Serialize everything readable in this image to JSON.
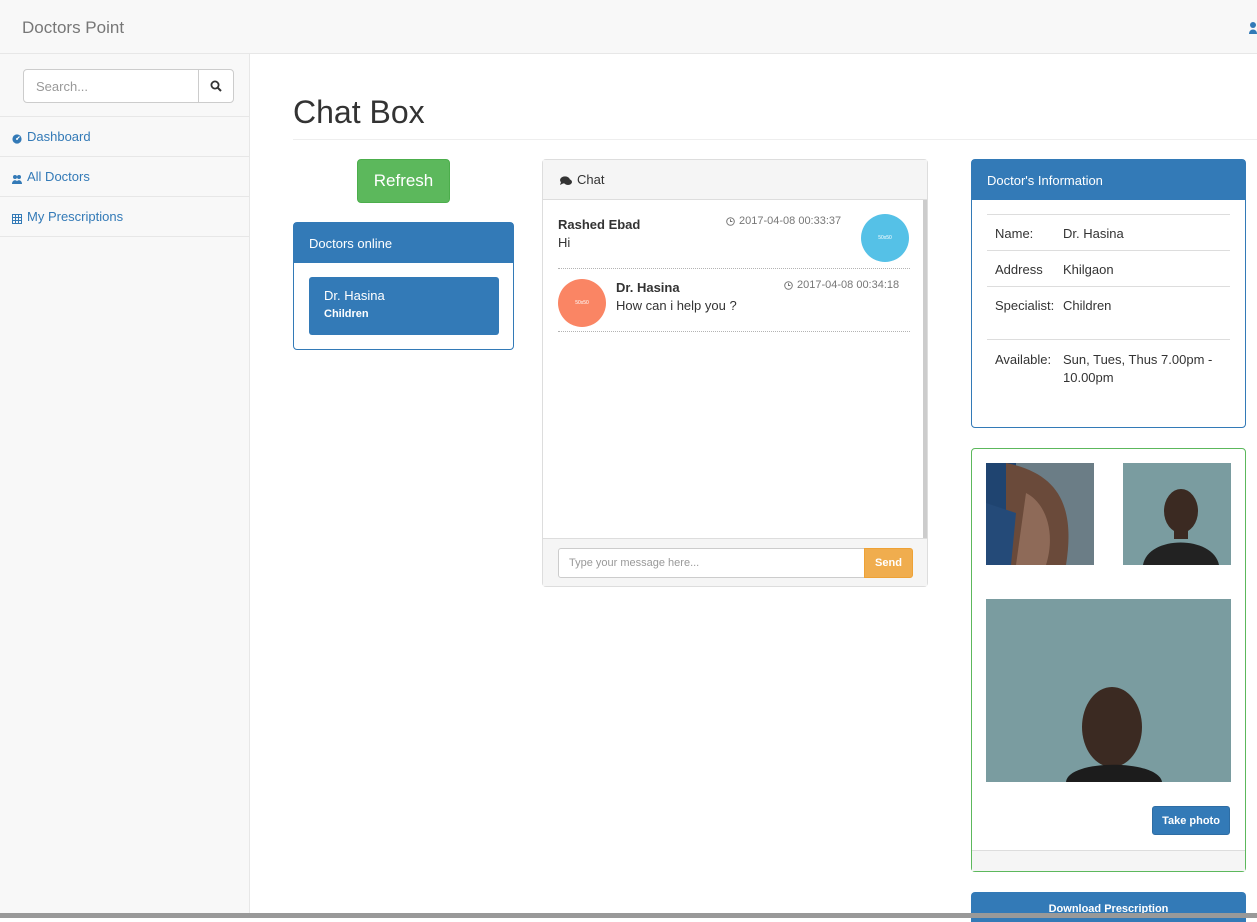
{
  "app": {
    "brand": "Doctors Point"
  },
  "search": {
    "placeholder": "Search..."
  },
  "sidebar": {
    "items": [
      {
        "label": "Dashboard",
        "icon": "dashboard-icon"
      },
      {
        "label": "All Doctors",
        "icon": "users-icon"
      },
      {
        "label": "My Prescriptions",
        "icon": "table-icon"
      }
    ]
  },
  "main": {
    "title": "Chat Box",
    "refresh_label": "Refresh"
  },
  "doctors_online": {
    "title": "Doctors online",
    "doctors": [
      {
        "name": "Dr. Hasina",
        "specialty": "Children"
      }
    ]
  },
  "chat": {
    "title": "Chat",
    "messages": [
      {
        "sender": "Rashed Ebad",
        "text": "Hi",
        "time": "2017-04-08 00:33:37",
        "side": "right",
        "avatar_color": "#55c1e7",
        "avatar_text": "50x50"
      },
      {
        "sender": "Dr. Hasina",
        "text": "How can i help you ?",
        "time": "2017-04-08 00:34:18",
        "side": "left",
        "avatar_color": "#fa8564",
        "avatar_text": "50x50"
      }
    ],
    "input_placeholder": "Type your message here...",
    "send_label": "Send"
  },
  "doctor_info": {
    "title": "Doctor's Information",
    "rows": [
      {
        "key": "Name:",
        "value": "Dr. Hasina"
      },
      {
        "key": "Address",
        "value": "Khilgaon"
      },
      {
        "key": "Specialist:",
        "value": "Children"
      },
      {
        "key": "Available:",
        "value": "Sun, Tues, Thus 7.00pm - 10.00pm"
      }
    ]
  },
  "camera": {
    "take_photo_label": "Take photo"
  },
  "download_label": "Download Prescription",
  "colors": {
    "primary": "#337ab7",
    "success": "#5cb85c",
    "warning": "#f0ad4e"
  }
}
